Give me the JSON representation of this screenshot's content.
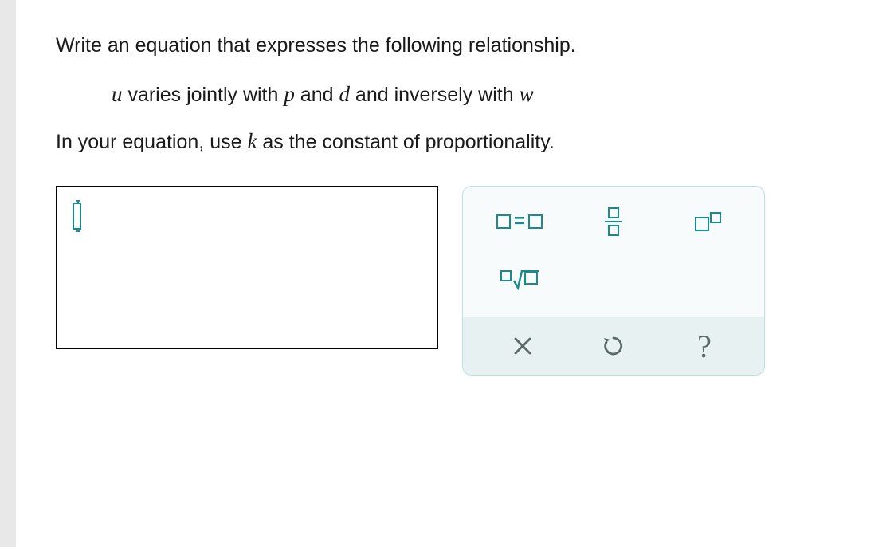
{
  "problem": {
    "intro": "Write an equation that expresses the following relationship.",
    "relationship_parts": {
      "p1": " varies jointly with ",
      "p2": " and ",
      "p3": " and inversely with "
    },
    "vars": {
      "u": "u",
      "p": "p",
      "d": "d",
      "w": "w",
      "k": "k"
    },
    "instruction_parts": {
      "pre": "In your equation, use ",
      "post": " as the constant of proportionality."
    }
  },
  "tools": {
    "equality": "=",
    "clear": "×",
    "undo": "↺",
    "help": "?"
  }
}
